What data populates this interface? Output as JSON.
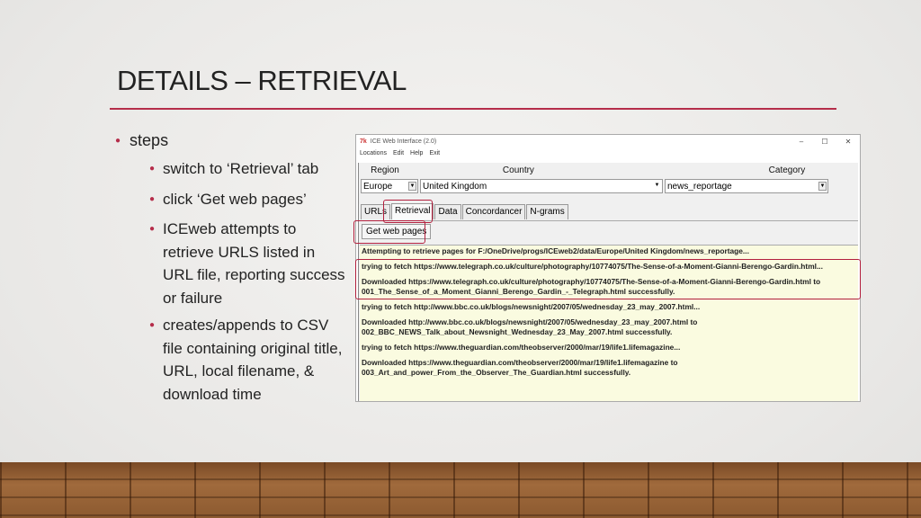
{
  "slide": {
    "title": "DETAILS – RETRIEVAL",
    "bullet_main": "steps",
    "sub_bullets": [
      "switch to ‘Retrieval’ tab",
      "click ‘Get web pages’",
      "ICEweb attempts to retrieve URLS listed in URL file, reporting success or failure",
      "creates/appends to CSV file containing original title, URL, local filename, & download time"
    ]
  },
  "window": {
    "title": "ICE Web Interface (2.0)",
    "menu": [
      "Locations",
      "Edit",
      "Help",
      "Exit"
    ],
    "controls": [
      "–",
      "☐",
      "✕"
    ],
    "headers": {
      "region": "Region",
      "country": "Country",
      "category": "Category"
    },
    "selects": {
      "region": "Europe",
      "country": "United Kingdom",
      "category": "news_reportage"
    },
    "tabs": [
      "URLs",
      "Retrieval",
      "Data",
      "Concordancer",
      "N-grams"
    ],
    "active_tab": "Retrieval",
    "get_button": "Get web pages",
    "log": [
      "Attempting to retrieve pages for F:/OneDrive/progs/ICEweb2/data/Europe/United Kingdom/news_reportage...",
      "trying to fetch https://www.telegraph.co.uk/culture/photography/10774075/The-Sense-of-a-Moment-Gianni-Berengo-Gardin.html...",
      "Downloaded https://www.telegraph.co.uk/culture/photography/10774075/The-Sense-of-a-Moment-Gianni-Berengo-Gardin.html to 001_The_Sense_of_a_Moment_Gianni_Berengo_Gardin_-_Telegraph.html successfully.",
      "trying to fetch http://www.bbc.co.uk/blogs/newsnight/2007/05/wednesday_23_may_2007.html...",
      "Downloaded http://www.bbc.co.uk/blogs/newsnight/2007/05/wednesday_23_may_2007.html to 002_BBC_NEWS_Talk_about_Newsnight_Wednesday_23_May_2007.html successfully.",
      "trying to fetch https://www.theguardian.com/theobserver/2000/mar/19/life1.lifemagazine...",
      "Downloaded https://www.theguardian.com/theobserver/2000/mar/19/life1.lifemagazine to 003_Art_and_power_From_the_Observer_The_Guardian.html successfully."
    ]
  }
}
